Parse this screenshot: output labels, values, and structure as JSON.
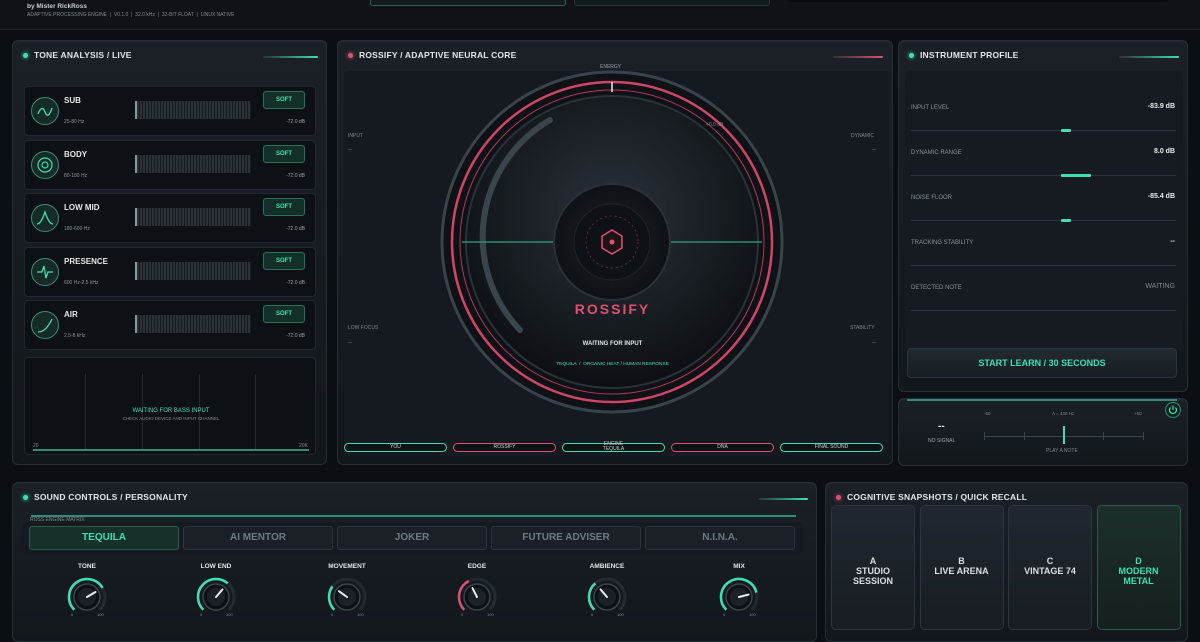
{
  "header": {
    "author": "by Mister RickRoss",
    "subtitle": "ADAPTIVE PROCESSING ENGINE  |  V0.1.0  |  32.0 kHz  |  32-BIT FLOAT  |  LINUX NATIVE"
  },
  "tone_panel": {
    "title": "TONE ANALYSIS / LIVE",
    "bands": [
      {
        "name": "SUB",
        "range": "25-80 Hz",
        "db": "-72.0 dB",
        "button": "SOFT",
        "icon": "sub-wave-icon"
      },
      {
        "name": "BODY",
        "range": "80-180 Hz",
        "db": "-72.0 dB",
        "button": "SOFT",
        "icon": "target-icon"
      },
      {
        "name": "LOW MID",
        "range": "180-600 Hz",
        "db": "-72.0 dB",
        "button": "SOFT",
        "icon": "bell-curve-icon"
      },
      {
        "name": "PRESENCE",
        "range": "600 Hz-2.5 kHz",
        "db": "-72.0 dB",
        "button": "SOFT",
        "icon": "pulse-icon"
      },
      {
        "name": "AIR",
        "range": "2.5-8 kHz",
        "db": "-72.0 dB",
        "button": "SOFT",
        "icon": "rise-curve-icon"
      }
    ],
    "spectrum": {
      "status": "WAITING FOR BASS INPUT",
      "hint": "CHECK AUDIO DEVICE AND INPUT CHANNEL",
      "x_min": "20",
      "x_max": "20K"
    }
  },
  "core_panel": {
    "title": "ROSSIFY / ADAPTIVE NEURAL CORE",
    "energy_label": "ENERGY",
    "input_label": "INPUT",
    "input_value": "--",
    "dynamic_label": "DYNAMIC",
    "dynamic_value": "--",
    "low_focus_label": "LOW FOCUS",
    "low_focus_value": "--",
    "stability_label": "STABILITY",
    "stability_value": "--",
    "gain_label": "+0.0 dB",
    "brand": "ROSSIFY",
    "status": "WAITING FOR INPUT",
    "tagline": "TEQUILA  /  ORGANIC HEAT / HUMAN RESPONSE",
    "chain": [
      {
        "label": "YOU",
        "color": "#3ee0b0"
      },
      {
        "label": "ROSSIFY",
        "color": "#e05070"
      },
      {
        "label": "ENGINE TEQUILA",
        "color": "#3ee0b0"
      },
      {
        "label": "DNA",
        "color": "#e05070"
      },
      {
        "label": "FINAL SOUND",
        "color": "#3ee0b0"
      }
    ]
  },
  "instrument_panel": {
    "title": "INSTRUMENT PROFILE",
    "rows": [
      {
        "label": "INPUT LEVEL",
        "value": "-83.9 dB"
      },
      {
        "label": "DYNAMIC RANGE",
        "value": "8.0 dB"
      },
      {
        "label": "NOISE FLOOR",
        "value": "-85.4 dB"
      },
      {
        "label": "TRACKING STABILITY",
        "value": "--"
      },
      {
        "label": "DETECTED NOTE",
        "value": "WAITING"
      }
    ],
    "learn_button": "START LEARN / 30 SECONDS"
  },
  "tuner": {
    "note": "--",
    "signal": "NO SIGNAL",
    "scale_left": "-50",
    "scale_center": "A = 440 Hz",
    "scale_right": "+50",
    "hint": "PLAY A NOTE",
    "power_icon": "power-icon"
  },
  "sound_panel": {
    "title": "SOUND CONTROLS / PERSONALITY",
    "matrix_label": "ROSS ENGINE MATRIX",
    "personalities": [
      "TEQUILA",
      "AI MENTOR",
      "JOKER",
      "FUTURE ADVISER",
      "N.I.N.A."
    ],
    "active_personality": "TEQUILA",
    "knobs": [
      {
        "label": "TONE",
        "min": "0",
        "max": "100",
        "level": 0.72
      },
      {
        "label": "LOW END",
        "min": "0",
        "max": "100",
        "level": 0.65
      },
      {
        "label": "MOVEMENT",
        "min": "0",
        "max": "100",
        "level": 0.3
      },
      {
        "label": "EDGE",
        "min": "0",
        "max": "100",
        "level": 0.4
      },
      {
        "label": "AMBIENCE",
        "min": "0",
        "max": "100",
        "level": 0.35
      },
      {
        "label": "MIX",
        "min": "0",
        "max": "100",
        "level": 0.78
      }
    ]
  },
  "snapshots_panel": {
    "title": "COGNITIVE SNAPSHOTS / QUICK RECALL",
    "snapshots": [
      {
        "letter": "A",
        "line1": "STUDIO",
        "line2": "SESSION"
      },
      {
        "letter": "B",
        "line1": "LIVE ARENA",
        "line2": ""
      },
      {
        "letter": "C",
        "line1": "VINTAGE 74",
        "line2": ""
      },
      {
        "letter": "D",
        "line1": "MODERN",
        "line2": "METAL"
      }
    ],
    "active_snapshot": "D"
  }
}
